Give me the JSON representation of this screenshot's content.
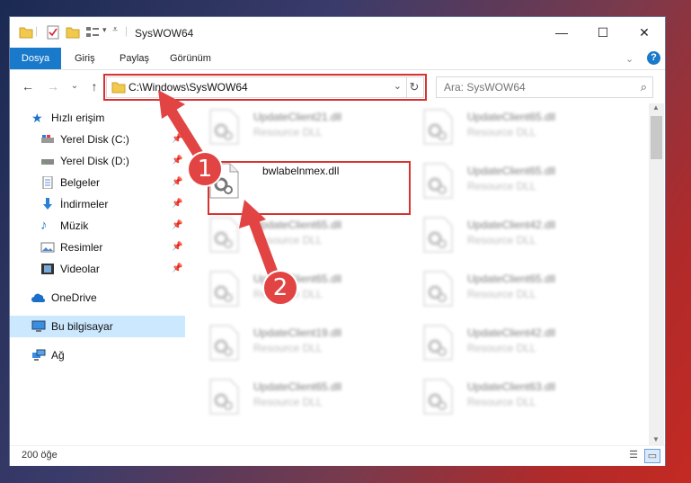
{
  "window": {
    "title": "SysWOW64",
    "minimize": "—",
    "maximize": "☐",
    "close": "✕"
  },
  "ribbon": {
    "tabs": [
      "Dosya",
      "Giriş",
      "Paylaş",
      "Görünüm"
    ],
    "help": "?"
  },
  "nav": {
    "back": "←",
    "forward": "→",
    "recent": "⌄",
    "up": "↑",
    "address": "C:\\Windows\\SysWOW64",
    "address_dropdown": "⌄",
    "refresh": "↻",
    "search_placeholder": "Ara: SysWOW64"
  },
  "sidebar": {
    "items": [
      {
        "label": "Hızlı erişim"
      },
      {
        "label": "Yerel Disk (C:)"
      },
      {
        "label": "Yerel Disk (D:)"
      },
      {
        "label": "Belgeler"
      },
      {
        "label": "İndirmeler"
      },
      {
        "label": "Müzik"
      },
      {
        "label": "Resimler"
      },
      {
        "label": "Videolar"
      },
      {
        "label": "OneDrive"
      },
      {
        "label": "Bu bilgisayar"
      },
      {
        "label": "Ağ"
      }
    ]
  },
  "files": [
    {
      "name": "UpdateClient21.dll",
      "desc": "Resource DLL"
    },
    {
      "name": "UpdateClient65.dll",
      "desc": "Resource DLL"
    },
    {
      "name": "bwlabelnmex.dll",
      "desc": ""
    },
    {
      "name": "UpdateClient65.dll",
      "desc": "Resource DLL"
    },
    {
      "name": "UpdateClient65.dll",
      "desc": "Resource DLL"
    },
    {
      "name": "UpdateClient42.dll",
      "desc": "Resource DLL"
    },
    {
      "name": "UpdateClient65.dll",
      "desc": "Resource DLL"
    },
    {
      "name": "UpdateClient65.dll",
      "desc": "Resource DLL"
    },
    {
      "name": "UpdateClient19.dll",
      "desc": "Resource DLL"
    },
    {
      "name": "UpdateClient42.dll",
      "desc": "Resource DLL"
    },
    {
      "name": "UpdateClient65.dll",
      "desc": "Resource DLL"
    },
    {
      "name": "UpdateClient63.dll",
      "desc": "Resource DLL"
    }
  ],
  "status": {
    "count": "200 öğe"
  },
  "annotations": {
    "badge1": "1",
    "badge2": "2"
  }
}
